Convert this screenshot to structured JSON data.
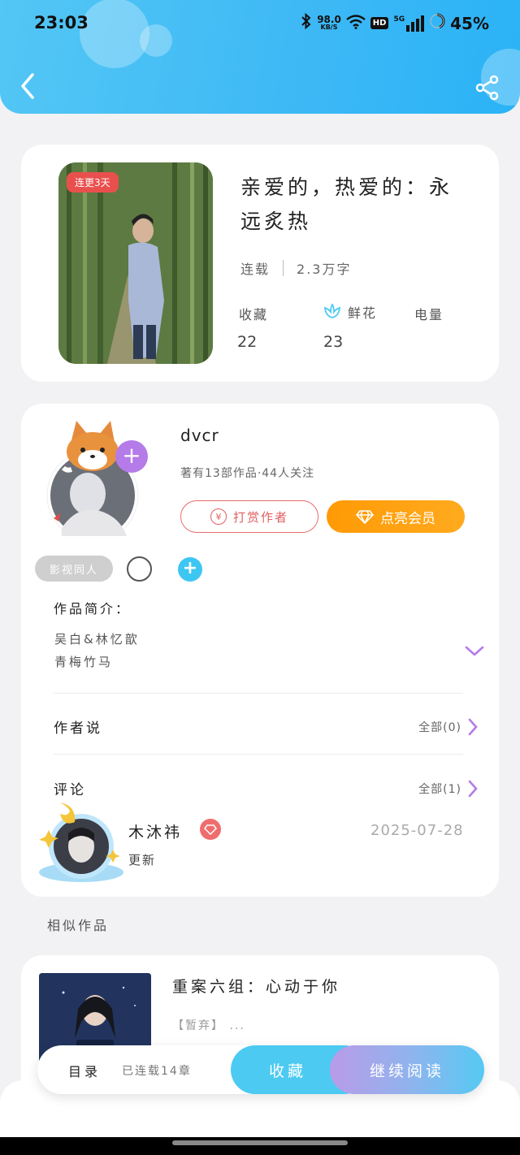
{
  "status_bar": {
    "time": "23:03",
    "net_speed": "98.0",
    "net_unit": "KB/S",
    "hd": "HD",
    "signal": "5G",
    "battery": "45%"
  },
  "book": {
    "badge": "连更3天",
    "title": "亲爱的，热爱的：永远炙热",
    "status": "连载",
    "word_count": "2.3万字",
    "stats": [
      {
        "label": "收藏",
        "value": "22"
      },
      {
        "label": "鲜花",
        "value": "23"
      },
      {
        "label": "电量",
        "value": ""
      }
    ]
  },
  "author": {
    "name": "dvcr",
    "info": "著有13部作品·44人关注",
    "tip_button": "打赏作者",
    "tip_icon": "¥",
    "vip_button": "点亮会员",
    "fan_tag": "影视同人"
  },
  "intro": {
    "title": "作品简介：",
    "lines": [
      "吴白&林忆歆",
      "青梅竹马"
    ]
  },
  "author_says": {
    "title": "作者说",
    "all_label": "全部(0)"
  },
  "comments": {
    "title": "评论",
    "all_label": "全部(1)",
    "items": [
      {
        "user": "木沐祎",
        "text": "更新",
        "date": "2025-07-28"
      }
    ]
  },
  "similar": {
    "title": "相似作品",
    "items": [
      {
        "title": "重案六组：心动于你",
        "tag": "【暂弃】 ..."
      }
    ]
  },
  "bottom_bar": {
    "toc": "目录",
    "chapters": "已连载14章",
    "favorite": "收藏",
    "continue": "继续阅读"
  },
  "colors": {
    "header_blue": "#3fb9f5",
    "vip_orange": "#ff9a05",
    "tip_red": "#e86b6b",
    "accent_purple": "#b57be8"
  }
}
